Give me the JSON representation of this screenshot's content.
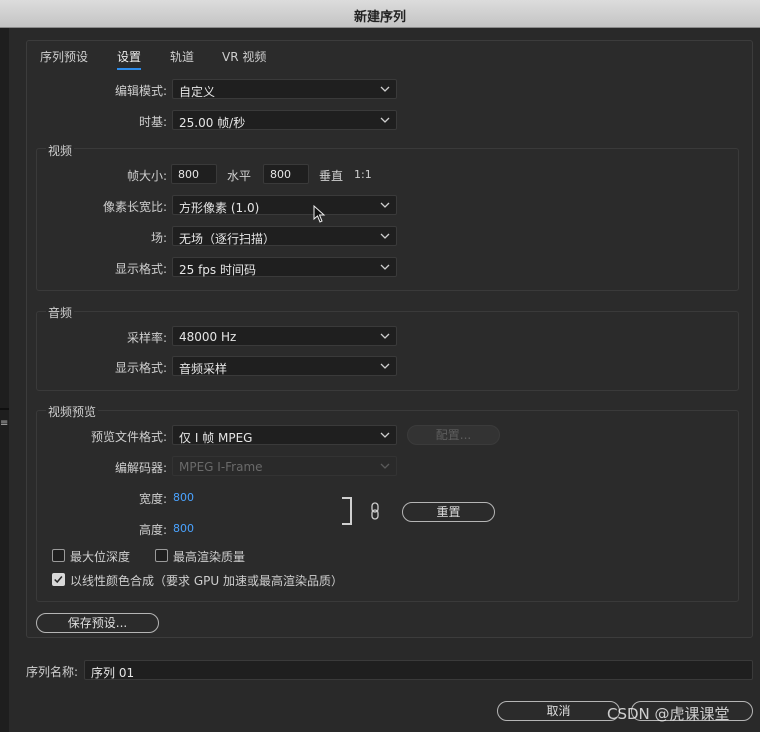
{
  "window": {
    "title": "新建序列"
  },
  "tabs": [
    {
      "label": "序列预设"
    },
    {
      "label": "设置",
      "active": true
    },
    {
      "label": "轨道"
    },
    {
      "label": "VR 视频"
    }
  ],
  "settings": {
    "edit_mode": {
      "label": "编辑模式:",
      "value": "自定义"
    },
    "timebase": {
      "label": "时基:",
      "value": "25.00  帧/秒"
    }
  },
  "video": {
    "title": "视频",
    "frame_size": {
      "label": "帧大小:",
      "width": "800",
      "h_label": "水平",
      "height": "800",
      "v_label": "垂直",
      "ratio": "1:1"
    },
    "pixel_aspect": {
      "label": "像素长宽比:",
      "value": "方形像素 (1.0)"
    },
    "fields": {
      "label": "场:",
      "value": "无场（逐行扫描）"
    },
    "display_format": {
      "label": "显示格式:",
      "value": "25 fps 时间码"
    }
  },
  "audio": {
    "title": "音频",
    "sample_rate": {
      "label": "采样率:",
      "value": "48000 Hz"
    },
    "display_format": {
      "label": "显示格式:",
      "value": "音频采样"
    }
  },
  "preview": {
    "title": "视频预览",
    "file_format": {
      "label": "预览文件格式:",
      "value": "仅 I 帧 MPEG"
    },
    "config_button": "配置...",
    "codec": {
      "label": "编解码器:",
      "value": "MPEG I-Frame"
    },
    "width": {
      "label": "宽度:",
      "value": "800"
    },
    "height": {
      "label": "高度:",
      "value": "800"
    },
    "reset_button": "重置",
    "max_bit_depth": {
      "label": "最大位深度",
      "checked": false
    },
    "max_render_quality": {
      "label": "最高渲染质量",
      "checked": false
    },
    "linear_color": {
      "label": "以线性颜色合成（要求 GPU 加速或最高渲染品质）",
      "checked": true
    }
  },
  "save_preset_button": "保存预设...",
  "sequence_name": {
    "label": "序列名称:",
    "value": "序列 01"
  },
  "cancel_button": "取消",
  "watermark": "CSDN @虎课课堂",
  "colors": {
    "accent": "#2d8ceb",
    "blue_value": "#4aa3ff",
    "background": "#292929"
  }
}
